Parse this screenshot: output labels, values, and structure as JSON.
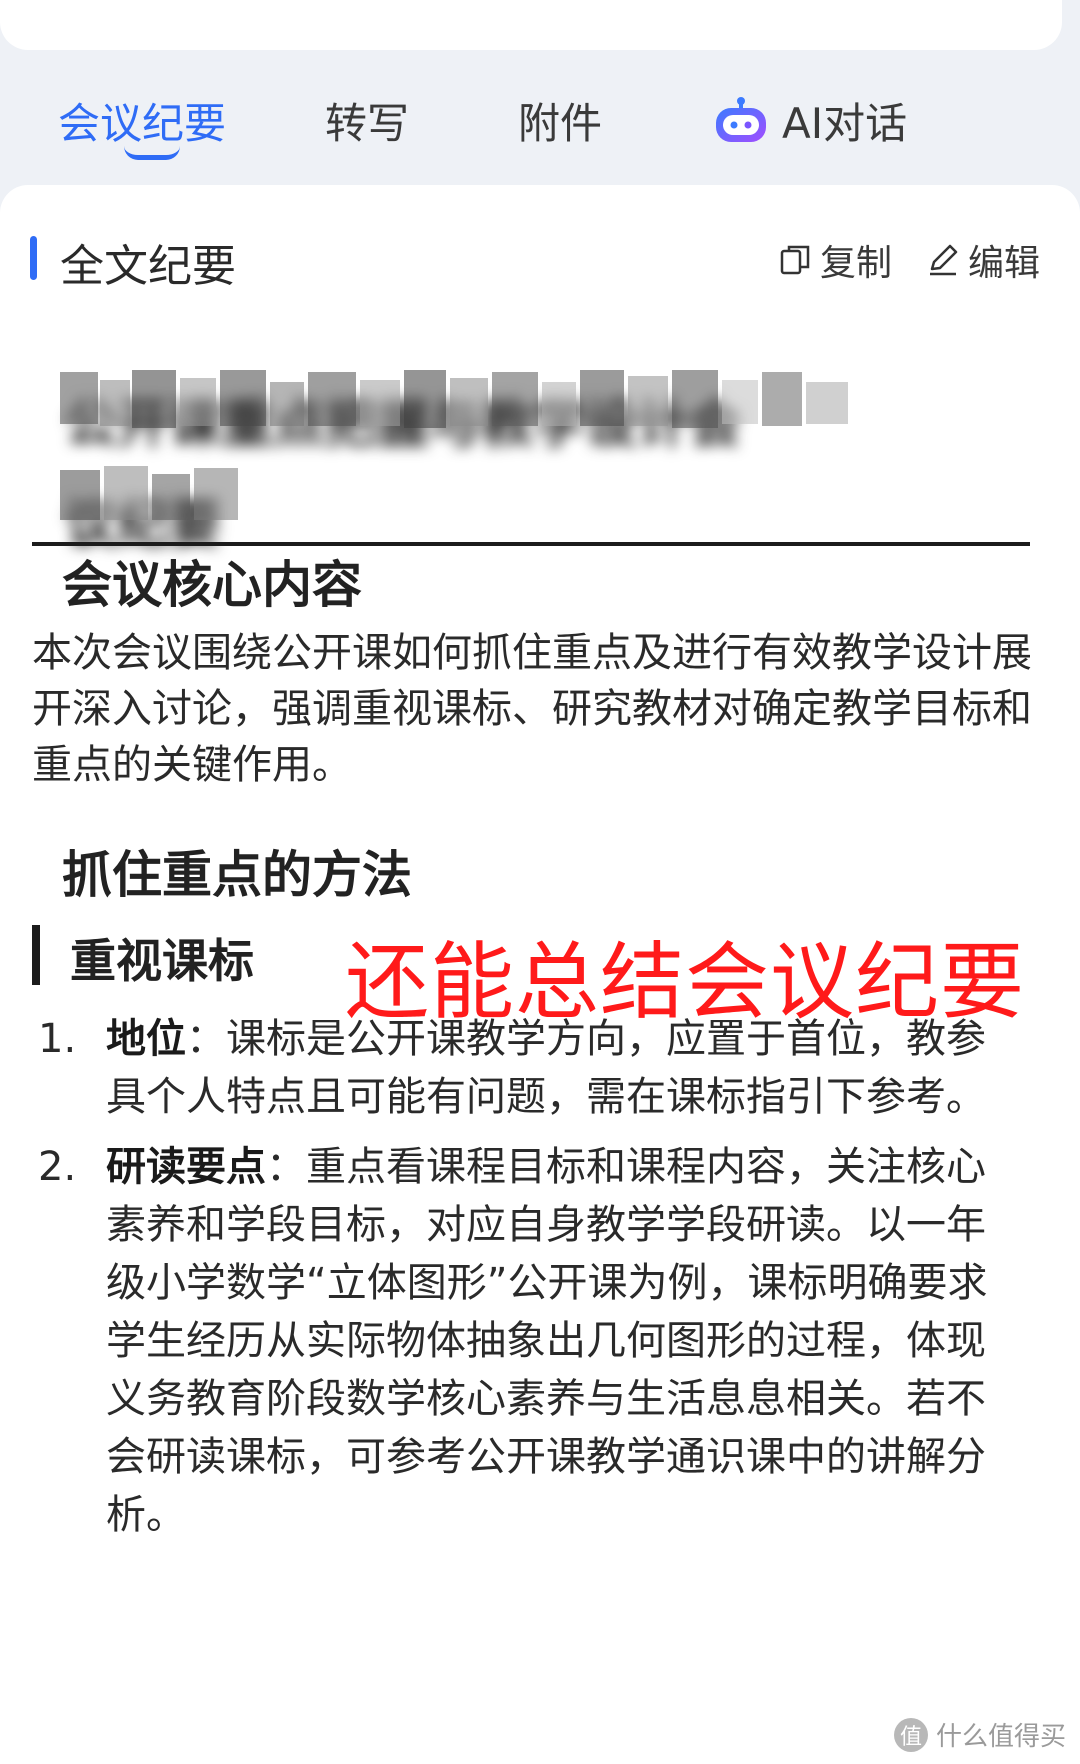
{
  "tabs": [
    {
      "label": "会议纪要",
      "active": true
    },
    {
      "label": "转写",
      "active": false
    },
    {
      "label": "附件",
      "active": false
    },
    {
      "label": "AI对话",
      "active": false,
      "icon": "robot-icon"
    }
  ],
  "section": {
    "title": "全文纪要",
    "actions": [
      {
        "label": "复制",
        "icon": "copy-icon"
      },
      {
        "label": "编辑",
        "icon": "edit-icon"
      }
    ]
  },
  "doc": {
    "title_line1": "公开课重点把握与教学设计会",
    "title_line2": "议纪要",
    "h_core": "会议核心内容",
    "core_paragraph": "本次会议围绕公开课如何抓住重点及进行有效教学设计展开深入讨论，强调重视课标、研究教材对确定教学目标和重点的关键作用。",
    "h_method": "抓住重点的方法",
    "h_subsection": "重视课标",
    "list": [
      {
        "num": "1.",
        "term": "地位",
        "text": "：课标是公开课教学方向，应置于首位，教参具个人特点且可能有问题，需在课标指引下参考。"
      },
      {
        "num": "2.",
        "term": "研读要点",
        "text": "：重点看课程目标和课程内容，关注核心素养和学段目标，对应自身教学学段研读。以一年级小学数学“立体图形”公开课为例，课标明确要求学生经历从实际物体抽象出几何图形的过程，体现义务教育阶段数学核心素养与生活息息相关。若不会研读课标，可参考公开课教学通识课中的讲解分析。"
      }
    ]
  },
  "overlay": {
    "text": "还能总结会议纪要",
    "color": "#ff1a1a"
  },
  "watermark": {
    "badge": "值",
    "text": "什么值得买"
  },
  "colors": {
    "accent": "#2f6cf6",
    "background": "#eef1f6"
  }
}
